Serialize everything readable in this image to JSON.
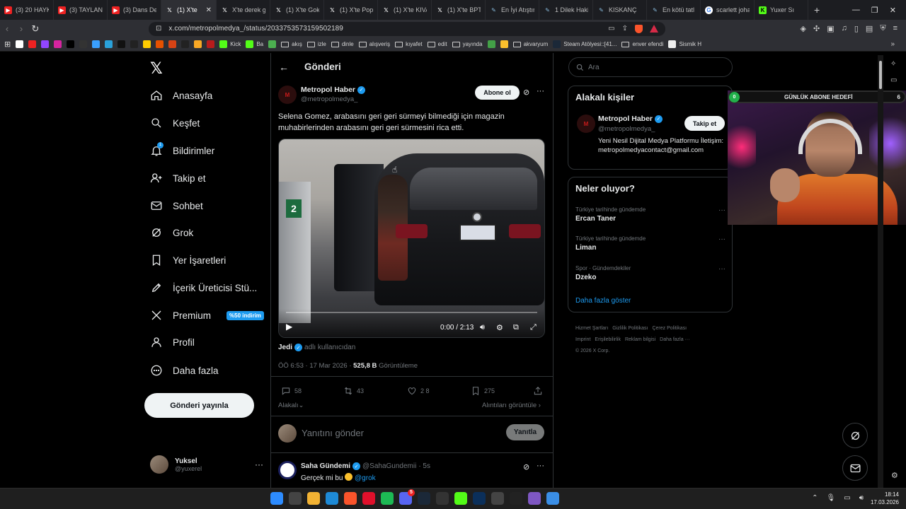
{
  "browser": {
    "tabs": [
      {
        "title": "(3) 20 HAYK",
        "icon": "youtube-icon",
        "active": false
      },
      {
        "title": "(3) TAYLANI",
        "icon": "youtube-icon",
        "active": false
      },
      {
        "title": "(3) Dans De",
        "icon": "youtube-icon",
        "active": false
      },
      {
        "title": "(1) X'te",
        "icon": "x-icon",
        "active": true
      },
      {
        "title": "X'te derek g",
        "icon": "x-icon",
        "active": false
      },
      {
        "title": "(1) X'te Gok",
        "icon": "x-icon",
        "active": false
      },
      {
        "title": "(1) X'te Pop",
        "icon": "x-icon",
        "active": false
      },
      {
        "title": "(1) X'te KIVA",
        "icon": "x-icon",
        "active": false
      },
      {
        "title": "(1) X'te BPT",
        "icon": "x-icon",
        "active": false
      },
      {
        "title": "En İyi Atıştır",
        "icon": "eksi-icon",
        "active": false
      },
      {
        "title": "1 Dilek Haki",
        "icon": "eksi-icon",
        "active": false
      },
      {
        "title": "KISKANÇ",
        "icon": "eksi-icon",
        "active": false
      },
      {
        "title": "En kötü tatl",
        "icon": "eksi-icon",
        "active": false
      },
      {
        "title": "scarlett joha",
        "icon": "google-icon",
        "active": false
      },
      {
        "title": "Yuxer Sı",
        "icon": "kick-icon",
        "active": false
      }
    ],
    "url": "x.com/metropolmedya_/status/2033753573159502189",
    "bookmarks": [
      {
        "label": "",
        "icon": "google-icon"
      },
      {
        "label": "",
        "icon": "youtube-icon"
      },
      {
        "label": "",
        "icon": "twitch-icon"
      },
      {
        "label": "",
        "icon": "instagram-icon"
      },
      {
        "label": "",
        "icon": "x-icon"
      },
      {
        "label": "",
        "icon": "github-icon"
      },
      {
        "label": "",
        "icon": "cloud-icon"
      },
      {
        "label": "",
        "icon": "telegram-icon"
      },
      {
        "label": "",
        "icon": "w-icon"
      },
      {
        "label": "",
        "icon": "wallet-icon"
      },
      {
        "label": "",
        "icon": "sahibinden-icon"
      },
      {
        "label": "",
        "icon": "play-icon"
      },
      {
        "label": "",
        "icon": "m-icon"
      },
      {
        "label": "",
        "icon": "amazon-icon"
      },
      {
        "label": "",
        "icon": "bolt-icon"
      },
      {
        "label": "",
        "icon": "n-icon"
      },
      {
        "label": "Kick",
        "icon": "kick-icon"
      },
      {
        "label": "Ba",
        "icon": "kick-icon"
      },
      {
        "label": "",
        "icon": "circle-icon"
      },
      {
        "label": "akış",
        "icon": "folder-icon"
      },
      {
        "label": "izle",
        "icon": "folder-icon"
      },
      {
        "label": "dinle",
        "icon": "folder-icon"
      },
      {
        "label": "alışveriş",
        "icon": "folder-icon"
      },
      {
        "label": "kıyafet",
        "icon": "folder-icon"
      },
      {
        "label": "edit",
        "icon": "folder-icon"
      },
      {
        "label": "yayında",
        "icon": "folder-icon"
      },
      {
        "label": "",
        "icon": "q-icon"
      },
      {
        "label": "",
        "icon": "tag-icon"
      },
      {
        "label": "akvaryum",
        "icon": "folder-icon"
      },
      {
        "label": "Steam Atölyesi::[41...",
        "icon": "steam-icon"
      },
      {
        "label": "enver efendi",
        "icon": "folder-icon"
      },
      {
        "label": "Sismik H",
        "icon": "globe-icon"
      }
    ]
  },
  "nav": {
    "items": [
      {
        "key": "home",
        "label": "Anasayfa"
      },
      {
        "key": "explore",
        "label": "Keşfet"
      },
      {
        "key": "notifications",
        "label": "Bildirimler"
      },
      {
        "key": "follow",
        "label": "Takip et"
      },
      {
        "key": "chat",
        "label": "Sohbet"
      },
      {
        "key": "grok",
        "label": "Grok"
      },
      {
        "key": "bookmarks",
        "label": "Yer İşaretleri"
      },
      {
        "key": "creator",
        "label": "İçerik Üreticisi Stü..."
      },
      {
        "key": "premium",
        "label": "Premium"
      },
      {
        "key": "profile",
        "label": "Profil"
      },
      {
        "key": "more",
        "label": "Daha fazla"
      }
    ],
    "notification_badge": "1",
    "premium_badge": "%50 indirim",
    "post_button": "Gönderi yayınla",
    "account": {
      "name": "Yuksel",
      "handle": "@yuxerel"
    }
  },
  "main": {
    "title": "Gönderi",
    "post": {
      "author_name": "Metropol Haber",
      "author_handle": "@metropolmedya_",
      "avatar_letter": "M",
      "subscribe": "Abone ol",
      "text": "Selena Gomez, arabasını geri geri sürmeyi bilmediği için magazin muhabirlerinden arabasını geri geri sürmesini rica etti.",
      "video": {
        "time": "0:00 / 2:13",
        "pump_number": "2",
        "progress": 0
      },
      "via_app": "Jedi",
      "via_text": "adlı kullanıcıdan",
      "timestamp": "ÖÖ 6:53 · 17 Mar 2026 ·",
      "views_count": "525,8 B",
      "views_label": "Görüntüleme",
      "actions": {
        "replies": "58",
        "reposts": "43",
        "likes": "2 8",
        "bookmarks": "275"
      },
      "relevant": "Alakalı",
      "quotes_link": "Alıntıları görüntüle ›"
    },
    "reply_placeholder": "Yanıtını gönder",
    "reply_button": "Yanıtla",
    "next_reply": {
      "name": "Saha Gündemi",
      "handle": "@SahaGundemii",
      "time": "· 5s",
      "text": "Gerçek mi bu",
      "mention": "@grok"
    }
  },
  "right": {
    "search_placeholder": "Ara",
    "people_title": "Alakalı kişiler",
    "person": {
      "name": "Metropol Haber",
      "handle": "@metropolmedya_",
      "avatar_letter": "M",
      "follow": "Takip et",
      "bio": "Yeni Nesil Dijital Medya Platformu İletişim:metropolmedyacontact@gmail.com"
    },
    "trends_title": "Neler oluyor?",
    "trends": [
      {
        "category": "Türkiye tarihinde gündemde",
        "name": "Ercan Taner"
      },
      {
        "category": "Türkiye tarihinde gündemde",
        "name": "Liman"
      },
      {
        "category": "Spor · Gündemdekiler",
        "name": "Dzeko"
      }
    ],
    "show_more": "Daha fazla göster",
    "footer": [
      "Hizmet Şartları",
      "Gizlilik Politikası",
      "Çerez Politikası",
      "Imprint",
      "Erişilebilirlik",
      "Reklam bilgisi",
      "Daha fazla ···",
      "© 2026 X Corp."
    ]
  },
  "webcam": {
    "bar_start": "0",
    "bar_title": "GÜNLÜK ABONE HEDEFİ",
    "bar_goal": "6"
  },
  "taskbar": {
    "time": "18:14",
    "date": "17.03.2026",
    "icons": [
      "windows-icon",
      "search-icon",
      "file-explorer-icon",
      "edge-icon",
      "brave-icon",
      "opera-icon",
      "spotify-icon",
      "discord-icon",
      "steam-icon",
      "terminal-icon",
      "kick-icon",
      "photoshop-icon",
      "chatgpt-icon",
      "epic-icon",
      "capcut-icon",
      "settings-icon"
    ],
    "discord_badge": "5"
  },
  "colors": {
    "accent": "#1d9bf0",
    "background": "#000000",
    "muted": "#71767b",
    "text": "#e7e9ea"
  }
}
